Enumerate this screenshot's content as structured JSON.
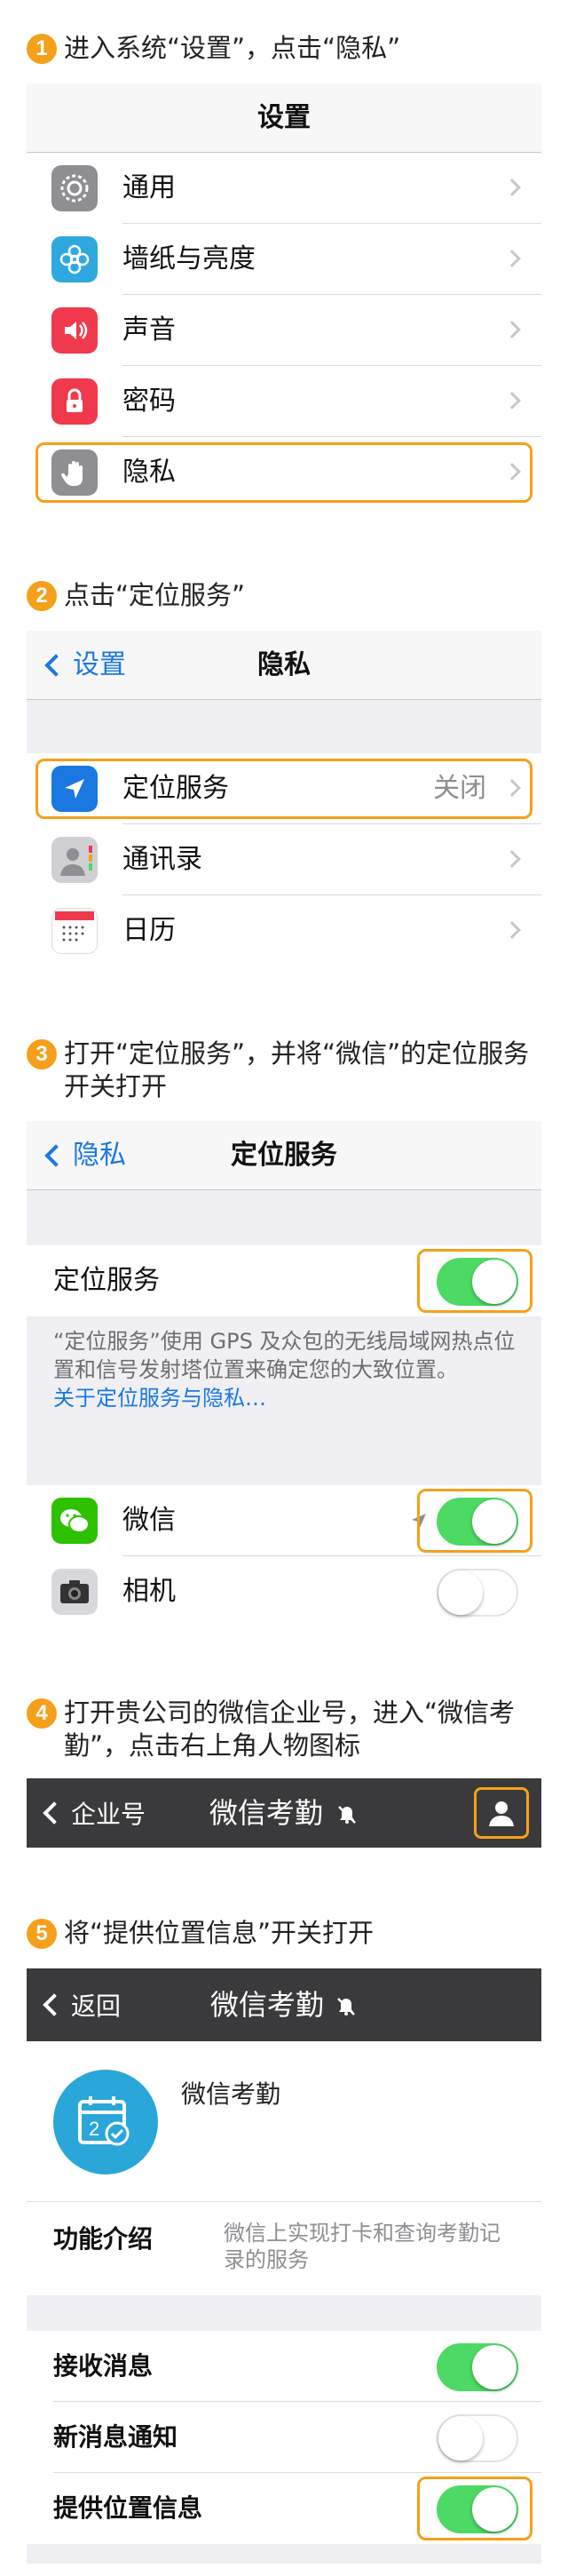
{
  "colors": {
    "accent": "#f5a01a",
    "ios_blue": "#1a78e0",
    "toggle_on": "#4cd964"
  },
  "steps": [
    {
      "num": "1",
      "text": "进入系统“设置”，点击“隐私”"
    },
    {
      "num": "2",
      "text": "点击“定位服务”"
    },
    {
      "num": "3",
      "text": "打开“定位服务”，并将“微信”的定位服务开关打开"
    },
    {
      "num": "4",
      "text": "打开贵公司的微信企业号，进入“微信考勤”，点击右上角人物图标"
    },
    {
      "num": "5",
      "text": "将“提供位置信息”开关打开"
    }
  ],
  "settings": {
    "title": "设置",
    "items": [
      {
        "label": "通用",
        "icon": "gear-icon"
      },
      {
        "label": "墙纸与亮度",
        "icon": "flower-icon"
      },
      {
        "label": "声音",
        "icon": "speaker-icon"
      },
      {
        "label": "密码",
        "icon": "lock-icon"
      },
      {
        "label": "隐私",
        "icon": "hand-icon"
      }
    ]
  },
  "privacy": {
    "back": "设置",
    "title": "隐私",
    "items": [
      {
        "label": "定位服务",
        "value": "关闭",
        "icon": "location-arrow-icon"
      },
      {
        "label": "通讯录",
        "icon": "contacts-icon"
      },
      {
        "label": "日历",
        "icon": "calendar-icon"
      }
    ]
  },
  "location": {
    "back": "隐私",
    "title": "定位服务",
    "master_label": "定位服务",
    "master_on": true,
    "note": "“定位服务”使用 GPS 及众包的无线局域网热点位置和信号发射塔位置来确定您的大致位置。",
    "note_link": "关于定位服务与隐私…",
    "apps": [
      {
        "label": "微信",
        "on": true,
        "icon": "wechat-icon"
      },
      {
        "label": "相机",
        "on": false,
        "icon": "camera-icon"
      }
    ]
  },
  "corp": {
    "back": "企业号",
    "title": "微信考勤"
  },
  "attendance": {
    "back": "返回",
    "title": "微信考勤",
    "app_name": "微信考勤",
    "intro_label": "功能介绍",
    "intro_text": "微信上实现打卡和查询考勤记录的服务",
    "settings": [
      {
        "label": "接收消息",
        "on": true
      },
      {
        "label": "新消息通知",
        "on": false
      },
      {
        "label": "提供位置信息",
        "on": true
      }
    ]
  }
}
